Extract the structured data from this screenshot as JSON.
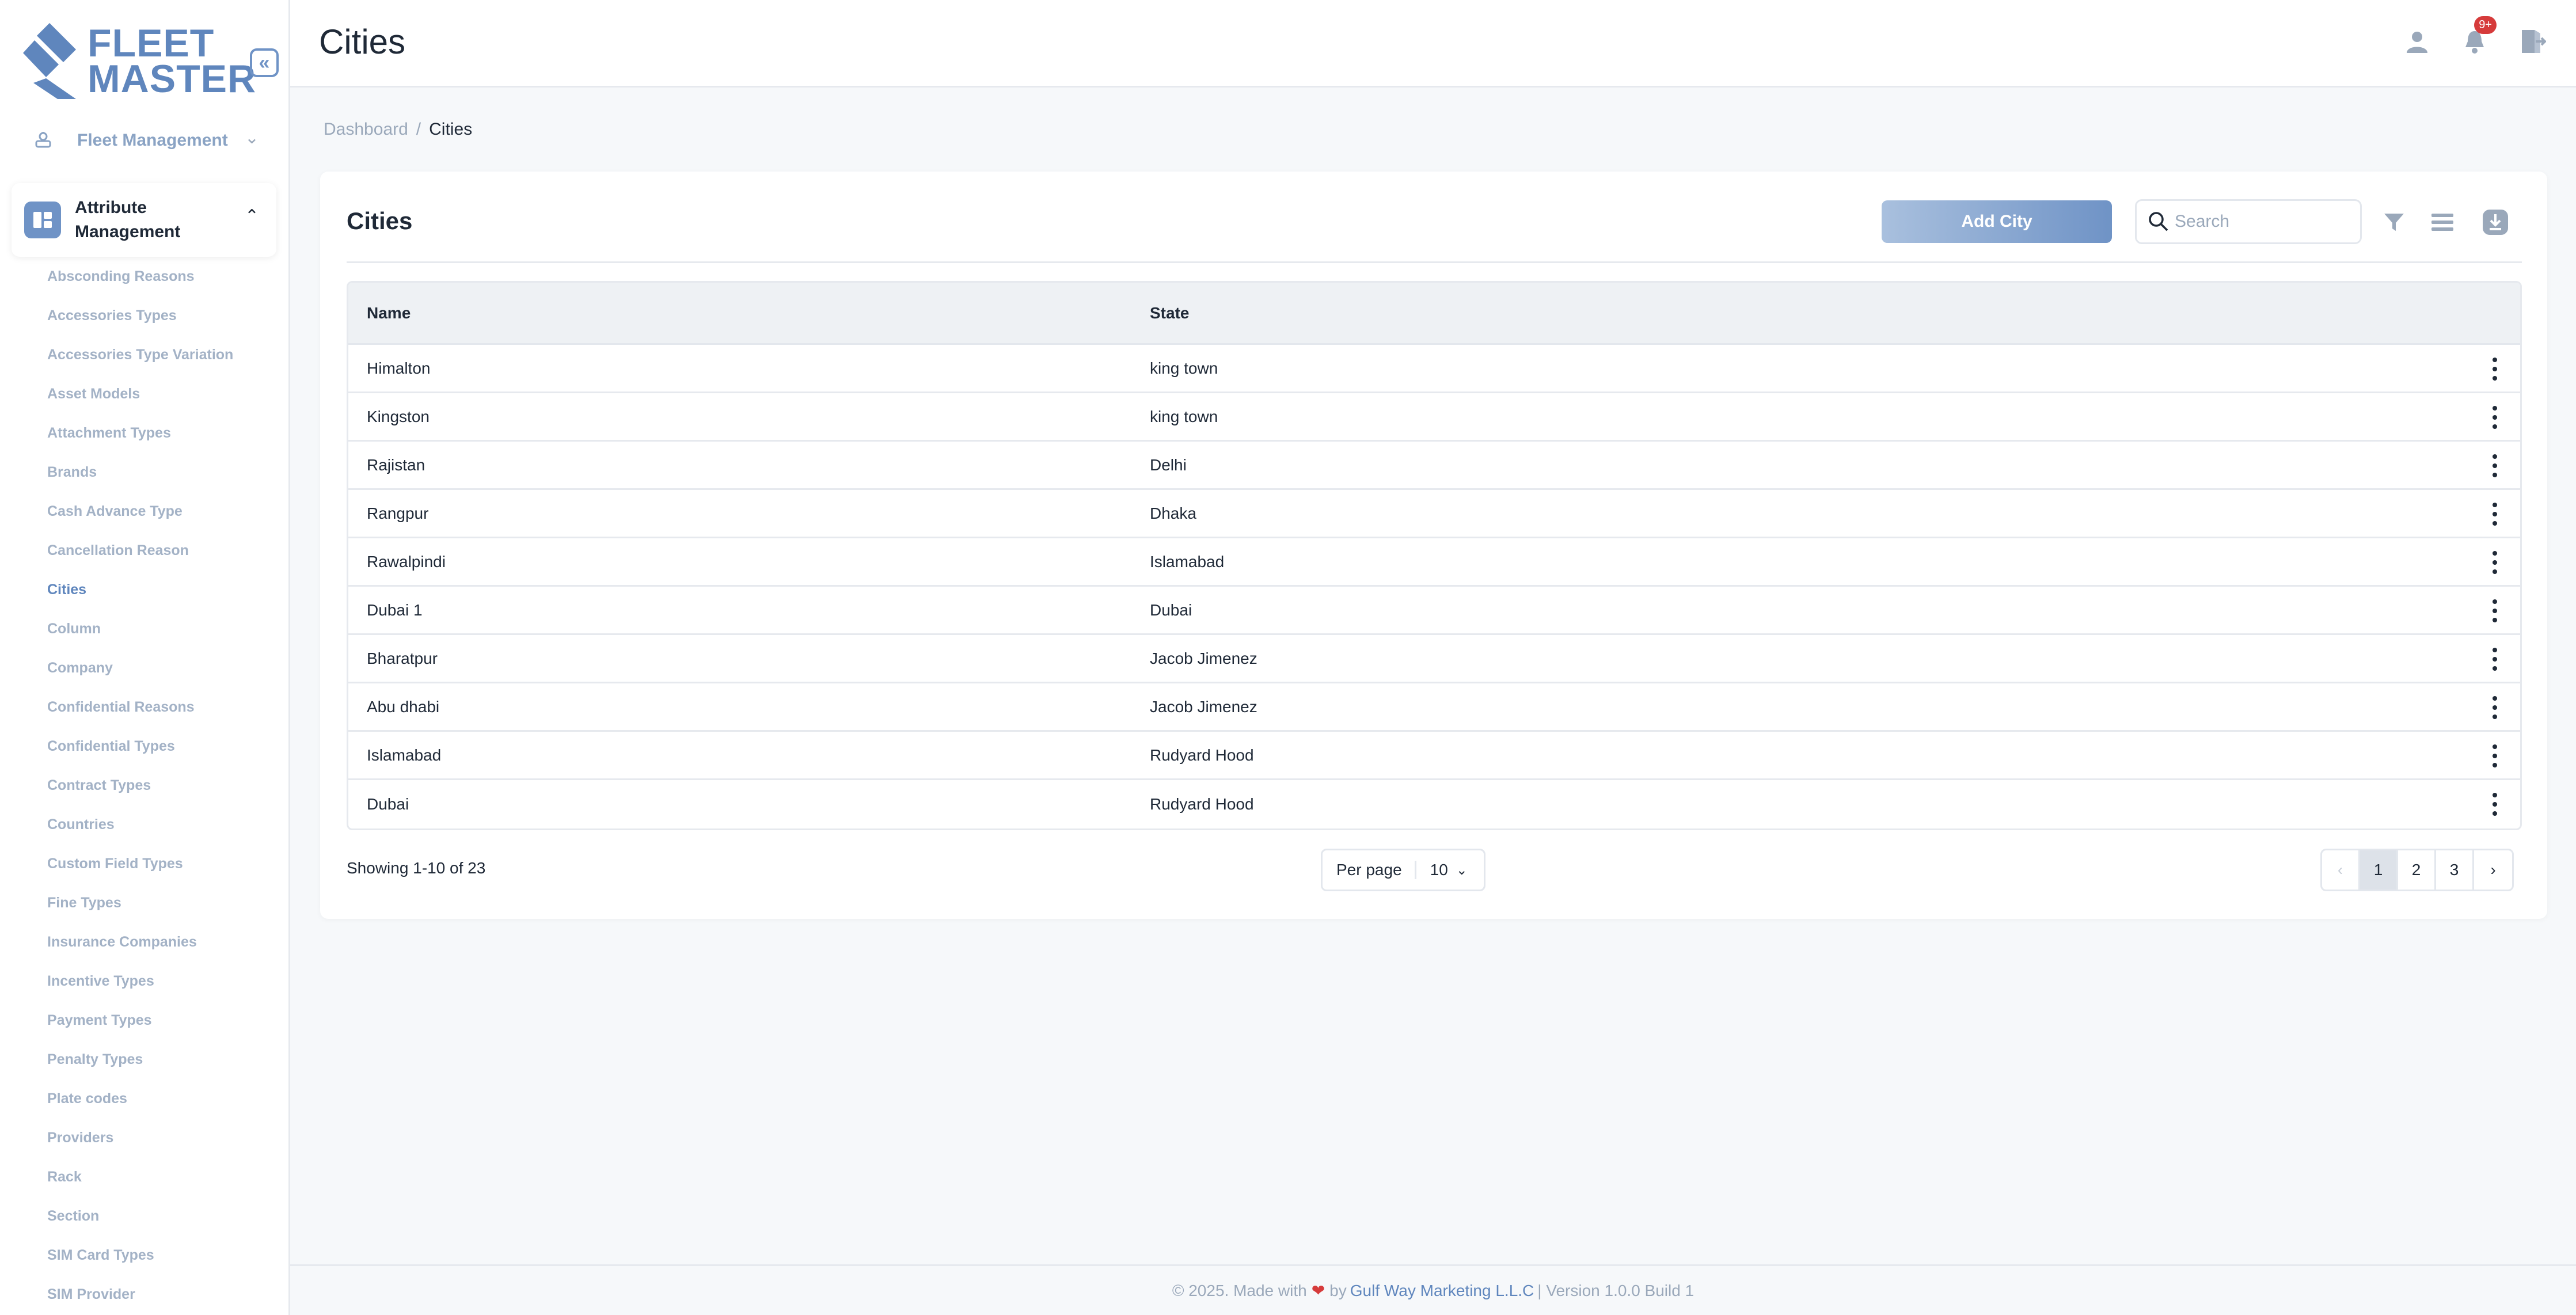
{
  "app": {
    "logo_line1": "FLEET",
    "logo_line2": "MASTER",
    "brand_color": "#5f86bd"
  },
  "sidebar": {
    "collapse_icon": "double-chevron-left-icon",
    "groups": [
      {
        "label": "Fleet Management",
        "icon": "car-icon",
        "expanded": false
      },
      {
        "label": "Attribute Management",
        "icon": "attributes-icon",
        "expanded": true
      }
    ],
    "items": [
      "Absconding Reasons",
      "Accessories Types",
      "Accessories Type Variation",
      "Asset Models",
      "Attachment Types",
      "Brands",
      "Cash Advance Type",
      "Cancellation Reason",
      "Cities",
      "Column",
      "Company",
      "Confidential Reasons",
      "Confidential Types",
      "Contract Types",
      "Countries",
      "Custom Field Types",
      "Fine Types",
      "Insurance Companies",
      "Incentive Types",
      "Payment Types",
      "Penalty Types",
      "Plate codes",
      "Providers",
      "Rack",
      "Section",
      "SIM Card Types",
      "SIM Provider"
    ],
    "active_item": "Cities"
  },
  "header": {
    "title": "Cities",
    "notification_badge": "9+"
  },
  "breadcrumb": {
    "home": "Dashboard",
    "separator": "/",
    "current": "Cities"
  },
  "card": {
    "title": "Cities",
    "add_button": "Add City",
    "search_placeholder": "Search"
  },
  "table": {
    "columns": [
      "Name",
      "State"
    ],
    "rows": [
      {
        "name": "Himalton",
        "state": "king town"
      },
      {
        "name": "Kingston",
        "state": "king town"
      },
      {
        "name": "Rajistan",
        "state": "Delhi"
      },
      {
        "name": "Rangpur",
        "state": "Dhaka"
      },
      {
        "name": "Rawalpindi",
        "state": "Islamabad"
      },
      {
        "name": "Dubai 1",
        "state": "Dubai"
      },
      {
        "name": "Bharatpur",
        "state": "Jacob Jimenez"
      },
      {
        "name": "Abu dhabi",
        "state": "Jacob Jimenez"
      },
      {
        "name": "Islamabad",
        "state": "Rudyard Hood"
      },
      {
        "name": "Dubai",
        "state": "Rudyard Hood"
      }
    ]
  },
  "pagination": {
    "showing": "Showing 1-10 of 23",
    "per_page_label": "Per page",
    "per_page_value": "10",
    "pages": [
      "1",
      "2",
      "3"
    ],
    "current_page": "1"
  },
  "footer": {
    "prefix": "© 2025. Made with",
    "by": "by",
    "company": "Gulf Way Marketing L.L.C",
    "version": "| Version 1.0.0 Build 1"
  }
}
